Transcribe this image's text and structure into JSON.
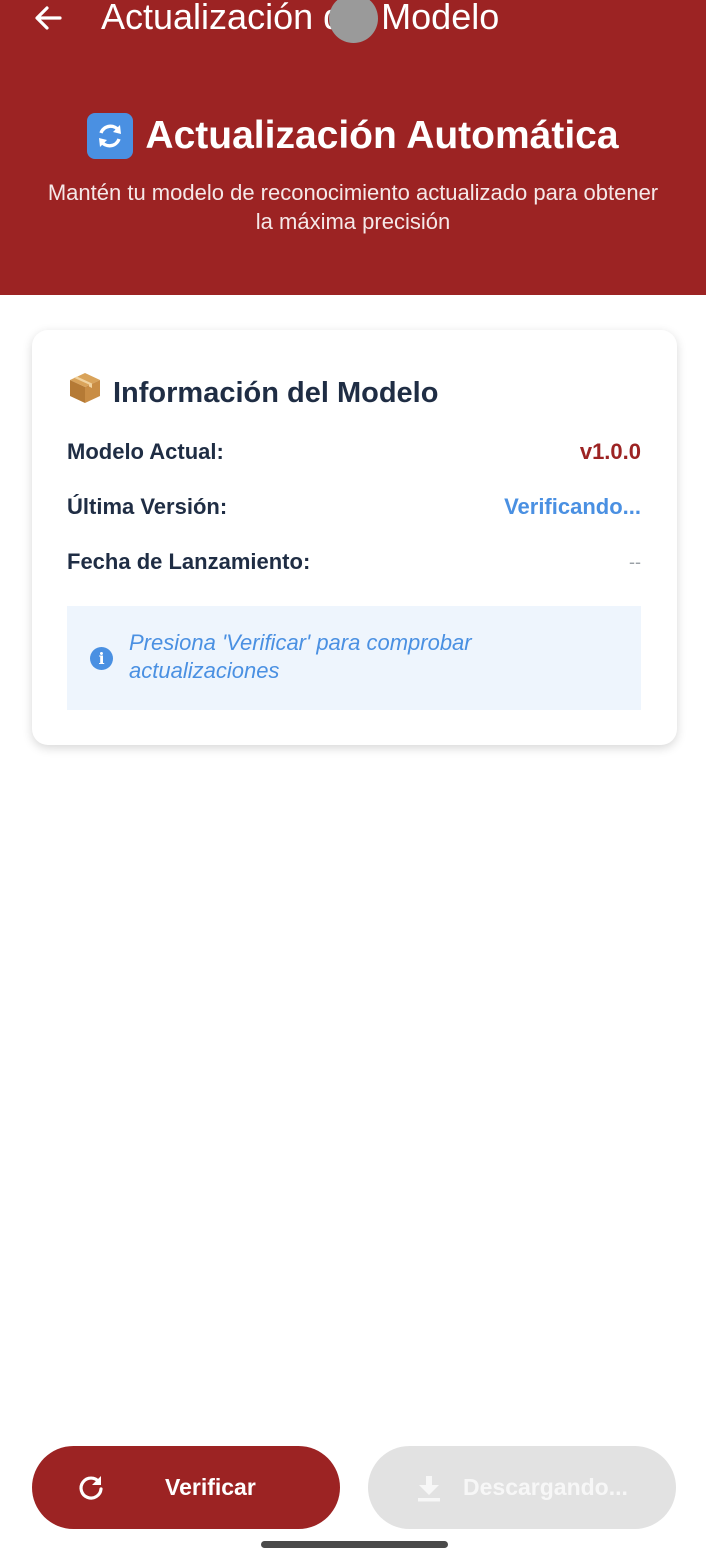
{
  "appbar": {
    "title": "Actualización del Modelo",
    "back_icon": "arrow-left-icon"
  },
  "hero": {
    "icon": "refresh-arrows-icon",
    "title": "Actualización Automática",
    "subtitle": "Mantén tu modelo de reconocimiento actualizado para obtener la máxima precisión"
  },
  "card": {
    "icon": "package-box-icon",
    "title": "Información del Modelo",
    "rows": [
      {
        "label": "Modelo Actual:",
        "value": "v1.0.0"
      },
      {
        "label": "Última Versión:",
        "value": "Verificando..."
      },
      {
        "label": "Fecha de Lanzamiento:",
        "value": "--"
      }
    ],
    "info": {
      "icon": "info-circle-icon",
      "text": "Presiona 'Verificar' para comprobar actualizaciones"
    }
  },
  "buttons": {
    "verify": {
      "label": "Verificar",
      "icon": "refresh-icon"
    },
    "download": {
      "label": "Descargando...",
      "icon": "download-icon"
    }
  },
  "colors": {
    "primary": "#9c2323",
    "accent_blue": "#4a90e2",
    "text_dark": "#1f2d44",
    "disabled": "#e2e2e2"
  }
}
